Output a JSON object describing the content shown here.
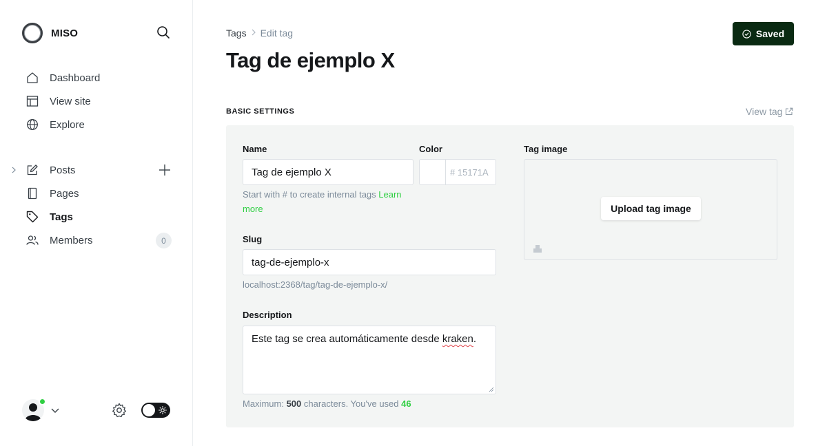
{
  "sidebar": {
    "brand": "MISO",
    "nav_top": [
      {
        "label": "Dashboard",
        "icon": "home-icon"
      },
      {
        "label": "View site",
        "icon": "layout-icon"
      },
      {
        "label": "Explore",
        "icon": "globe-icon"
      }
    ],
    "nav_mid": [
      {
        "label": "Posts",
        "icon": "pencil-square-icon"
      },
      {
        "label": "Pages",
        "icon": "page-icon"
      },
      {
        "label": "Tags",
        "icon": "tag-icon",
        "active": true
      },
      {
        "label": "Members",
        "icon": "members-icon",
        "count": "0"
      }
    ]
  },
  "header": {
    "breadcrumb_root": "Tags",
    "breadcrumb_current": "Edit tag",
    "title": "Tag de ejemplo X",
    "saved_label": "Saved"
  },
  "settings": {
    "section_title": "BASIC SETTINGS",
    "view_tag": "View tag",
    "name_label": "Name",
    "name_value": "Tag de ejemplo X",
    "name_hint": "Start with # to create internal tags",
    "name_hint_link": "Learn more",
    "color_label": "Color",
    "color_hash": "#",
    "color_placeholder": "15171A",
    "slug_label": "Slug",
    "slug_value": "tag-de-ejemplo-x",
    "slug_url": "localhost:2368/tag/tag-de-ejemplo-x/",
    "description_label": "Description",
    "description_text_1": "Este tag se crea automáticamente desde ",
    "description_text_2": "kraken",
    "description_text_3": ".",
    "desc_hint_prefix": "Maximum: ",
    "desc_max": "500",
    "desc_hint_mid": " characters. You've used ",
    "desc_used": "46",
    "image_label": "Tag image",
    "upload_label": "Upload tag image"
  },
  "colors": {
    "accent_green": "#30cf43",
    "saved_button_bg": "#0a2a12",
    "panel_bg": "#f3f5f4"
  }
}
